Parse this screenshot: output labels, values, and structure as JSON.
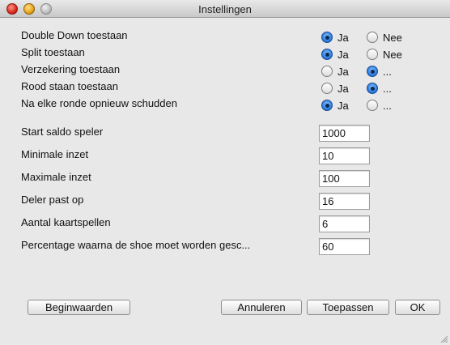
{
  "window": {
    "title": "Instellingen"
  },
  "options": [
    {
      "label": "Double Down toestaan",
      "yes": "Ja",
      "no": "Nee",
      "selected": "yes"
    },
    {
      "label": "Split toestaan",
      "yes": "Ja",
      "no": "Nee",
      "selected": "yes"
    },
    {
      "label": "Verzekering toestaan",
      "yes": "Ja",
      "no": "...",
      "selected": "no"
    },
    {
      "label": "Rood staan toestaan",
      "yes": "Ja",
      "no": "...",
      "selected": "no"
    },
    {
      "label": "Na elke ronde opnieuw schudden",
      "yes": "Ja",
      "no": "...",
      "selected": "yes"
    }
  ],
  "fields": [
    {
      "label": "Start saldo speler",
      "value": "1000"
    },
    {
      "label": "Minimale inzet",
      "value": "10"
    },
    {
      "label": "Maximale inzet",
      "value": "100"
    },
    {
      "label": "Deler past op",
      "value": "16"
    },
    {
      "label": "Aantal kaartspellen",
      "value": "6"
    },
    {
      "label": "Percentage waarna de shoe moet worden gesc...",
      "value": "60"
    }
  ],
  "buttons": {
    "defaults": "Beginwaarden",
    "cancel": "Annuleren",
    "apply": "Toepassen",
    "ok": "OK"
  },
  "colors": {
    "radio_selected": "#2f7fe0",
    "window_bg": "#e8e8e8"
  }
}
